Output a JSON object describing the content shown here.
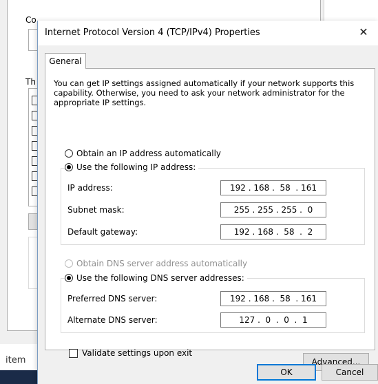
{
  "background": {
    "connect_label": "Co",
    "this_label": "Th",
    "item_label": "item"
  },
  "dialog": {
    "title": "Internet Protocol Version 4 (TCP/IPv4) Properties",
    "close_glyph": "✕",
    "tabs": [
      {
        "label": "General",
        "active": true
      }
    ],
    "intro": "You can get IP settings assigned automatically if your network supports this capability. Otherwise, you need to ask your network administrator for the appropriate IP settings.",
    "ip": {
      "auto_label": "Obtain an IP address automatically",
      "manual_label": "Use the following IP address:",
      "manual_selected": true,
      "fields": [
        {
          "label": "IP address:",
          "value": "192 . 168 .  58  . 161"
        },
        {
          "label": "Subnet mask:",
          "value": "255 . 255 . 255 .  0"
        },
        {
          "label": "Default gateway:",
          "value": "192 . 168 .  58  .  2"
        }
      ]
    },
    "dns": {
      "auto_label": "Obtain DNS server address automatically",
      "manual_label": "Use the following DNS server addresses:",
      "manual_selected": true,
      "fields": [
        {
          "label": "Preferred DNS server:",
          "value": "192 . 168 .  58  . 161"
        },
        {
          "label": "Alternate DNS server:",
          "value": "127 .  0  .  0  .  1"
        }
      ]
    },
    "validate_label": "Validate settings upon exit",
    "validate_checked": false,
    "advanced_label": "Advanced...",
    "ok_label": "OK",
    "cancel_label": "Cancel"
  }
}
